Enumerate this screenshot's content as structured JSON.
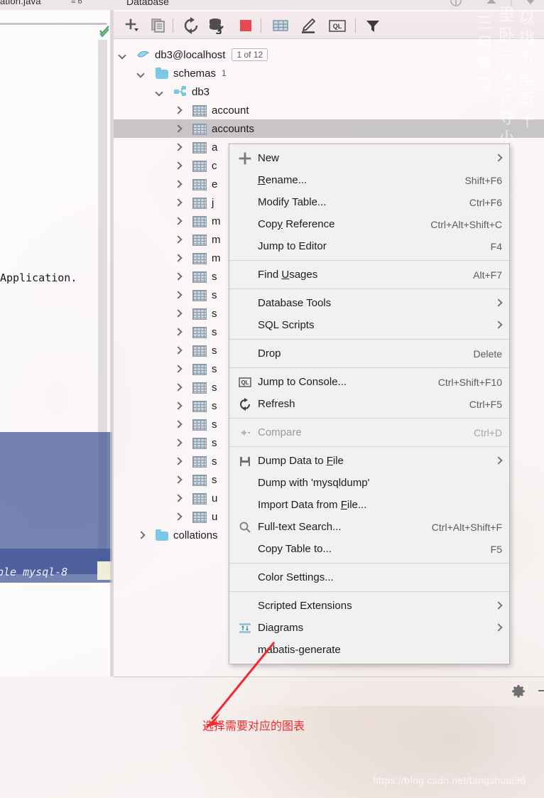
{
  "window": {
    "editor_tab": "ation.java",
    "editor_tab_badge": "≡ 6",
    "tool_window_title": "Database"
  },
  "editor": {
    "code_line": "Application.",
    "selected_text": "ple mysql-8",
    "inspection_icon": "inspection-ok-icon"
  },
  "toolbar": {
    "buttons": [
      {
        "name": "add-data-source-button",
        "icon": "plus-dropdown-icon",
        "title": "New"
      },
      {
        "name": "copy-button",
        "icon": "copy-icon",
        "title": "Duplicate"
      },
      {
        "name": "synchronize-button",
        "icon": "refresh-icon",
        "title": "Synchronize"
      },
      {
        "name": "data-source-properties-button",
        "icon": "wrench-icon",
        "title": "Data Source Properties"
      },
      {
        "name": "stop-button",
        "icon": "stop-square-icon",
        "title": "Stop"
      },
      {
        "name": "open-table-editor-button",
        "icon": "table-icon",
        "title": "Data Editor"
      },
      {
        "name": "modify-button",
        "icon": "pencil-icon",
        "title": "Modify"
      },
      {
        "name": "open-console-button",
        "icon": "ql-console-icon",
        "title": "Jump to Query Console"
      },
      {
        "name": "filter-button",
        "icon": "filter-funnel-icon",
        "title": "Filter"
      }
    ]
  },
  "tree": {
    "root": {
      "label": "db3@localhost",
      "badge": "1 of 12",
      "icon": "mysql-dolphin-icon",
      "expanded": true
    },
    "schemas": {
      "label": "schemas",
      "count": "1",
      "icon": "folder-icon",
      "expanded": true
    },
    "database": {
      "label": "db3",
      "icon": "schema-icon",
      "expanded": true
    },
    "tables": [
      {
        "label": "account",
        "icon": "table-icon",
        "selected": false
      },
      {
        "label": "accounts",
        "icon": "table-icon",
        "selected": true
      },
      {
        "label": "a",
        "icon": "table-icon",
        "selected": false
      },
      {
        "label": "c",
        "icon": "table-icon",
        "selected": false
      },
      {
        "label": "e",
        "icon": "table-icon",
        "selected": false
      },
      {
        "label": "j",
        "icon": "table-icon",
        "selected": false
      },
      {
        "label": "m",
        "icon": "table-icon",
        "selected": false
      },
      {
        "label": "m",
        "icon": "table-icon",
        "selected": false
      },
      {
        "label": "m",
        "icon": "table-icon",
        "selected": false
      },
      {
        "label": "s",
        "icon": "table-icon",
        "selected": false
      },
      {
        "label": "s",
        "icon": "table-icon",
        "selected": false
      },
      {
        "label": "s",
        "icon": "table-icon",
        "selected": false
      },
      {
        "label": "s",
        "icon": "table-icon",
        "selected": false
      },
      {
        "label": "s",
        "icon": "table-icon",
        "selected": false
      },
      {
        "label": "s",
        "icon": "table-icon",
        "selected": false
      },
      {
        "label": "s",
        "icon": "table-icon",
        "selected": false
      },
      {
        "label": "s",
        "icon": "table-icon",
        "selected": false
      },
      {
        "label": "s",
        "icon": "table-icon",
        "selected": false
      },
      {
        "label": "s",
        "icon": "table-icon",
        "selected": false
      },
      {
        "label": "s",
        "icon": "table-icon",
        "selected": false
      },
      {
        "label": "s",
        "icon": "table-icon",
        "selected": false
      },
      {
        "label": "u",
        "icon": "table-icon",
        "selected": false
      },
      {
        "label": "u",
        "icon": "table-icon",
        "selected": false
      }
    ],
    "collations": {
      "label": "collations",
      "icon": "folder-icon"
    }
  },
  "context_menu": {
    "items": [
      {
        "label": "New",
        "shortcut": "",
        "icon": "plus-icon",
        "submenu": true,
        "disabled": false,
        "sep_after": false
      },
      {
        "label": "Rename...",
        "shortcut": "Shift+F6",
        "icon": "",
        "submenu": false,
        "disabled": false,
        "sep_after": false,
        "mnemonic": "R"
      },
      {
        "label": "Modify Table...",
        "shortcut": "Ctrl+F6",
        "icon": "",
        "submenu": false,
        "disabled": false,
        "sep_after": false
      },
      {
        "label": "Copy Reference",
        "shortcut": "Ctrl+Alt+Shift+C",
        "icon": "",
        "submenu": false,
        "disabled": false,
        "sep_after": false,
        "mnemonic": "y"
      },
      {
        "label": "Jump to Editor",
        "shortcut": "F4",
        "icon": "",
        "submenu": false,
        "disabled": false,
        "sep_after": true
      },
      {
        "label": "Find Usages",
        "shortcut": "Alt+F7",
        "icon": "",
        "submenu": false,
        "disabled": false,
        "sep_after": true,
        "mnemonic": "U"
      },
      {
        "label": "Database Tools",
        "shortcut": "",
        "icon": "",
        "submenu": true,
        "disabled": false,
        "sep_after": false
      },
      {
        "label": "SQL Scripts",
        "shortcut": "",
        "icon": "",
        "submenu": true,
        "disabled": false,
        "sep_after": true
      },
      {
        "label": "Drop",
        "shortcut": "Delete",
        "icon": "",
        "submenu": false,
        "disabled": false,
        "sep_after": true
      },
      {
        "label": "Jump to Console...",
        "shortcut": "Ctrl+Shift+F10",
        "icon": "ql-console-icon",
        "submenu": false,
        "disabled": false,
        "sep_after": false
      },
      {
        "label": "Refresh",
        "shortcut": "Ctrl+F5",
        "icon": "refresh-icon",
        "submenu": false,
        "disabled": false,
        "sep_after": true
      },
      {
        "label": "Compare",
        "shortcut": "Ctrl+D",
        "icon": "compare-icon",
        "submenu": false,
        "disabled": true,
        "sep_after": true
      },
      {
        "label": "Dump Data to File",
        "shortcut": "",
        "icon": "save-disk-icon",
        "submenu": true,
        "disabled": false,
        "sep_after": false,
        "mnemonic": "F"
      },
      {
        "label": "Dump with 'mysqldump'",
        "shortcut": "",
        "icon": "",
        "submenu": false,
        "disabled": false,
        "sep_after": false
      },
      {
        "label": "Import Data from File...",
        "shortcut": "",
        "icon": "",
        "submenu": false,
        "disabled": false,
        "sep_after": false,
        "mnemonic": "F"
      },
      {
        "label": "Full-text Search...",
        "shortcut": "Ctrl+Alt+Shift+F",
        "icon": "search-icon",
        "submenu": false,
        "disabled": false,
        "sep_after": false
      },
      {
        "label": "Copy Table to...",
        "shortcut": "F5",
        "icon": "",
        "submenu": false,
        "disabled": false,
        "sep_after": true
      },
      {
        "label": "Color Settings...",
        "shortcut": "",
        "icon": "",
        "submenu": false,
        "disabled": false,
        "sep_after": true
      },
      {
        "label": "Scripted Extensions",
        "shortcut": "",
        "icon": "",
        "submenu": true,
        "disabled": false,
        "sep_after": false
      },
      {
        "label": "Diagrams",
        "shortcut": "",
        "icon": "diagram-icon",
        "submenu": true,
        "disabled": false,
        "sep_after": false
      },
      {
        "label": "mabatis-generate",
        "shortcut": "",
        "icon": "",
        "submenu": false,
        "disabled": false,
        "sep_after": false
      }
    ]
  },
  "status": {
    "settings_icon": "gear-icon",
    "hide_icon": "hide-icon"
  },
  "annotation": {
    "text": "选择需要对应的图表",
    "color": "#f1282c"
  },
  "watermarks": {
    "csdn": "https://blog.csdn.net/tangshuai96",
    "poem_line_1": "三月春盈",
    "poem_line_2": "里卧一朵妩夺小土吕矣",
    "poem_line_3": "以挑苏虽贡十"
  },
  "colors": {
    "accent_red": "#e8484f",
    "folder_blue": "#79c8e8",
    "selection_blue": "#40549a",
    "menu_bg": "#f1f1f1"
  }
}
